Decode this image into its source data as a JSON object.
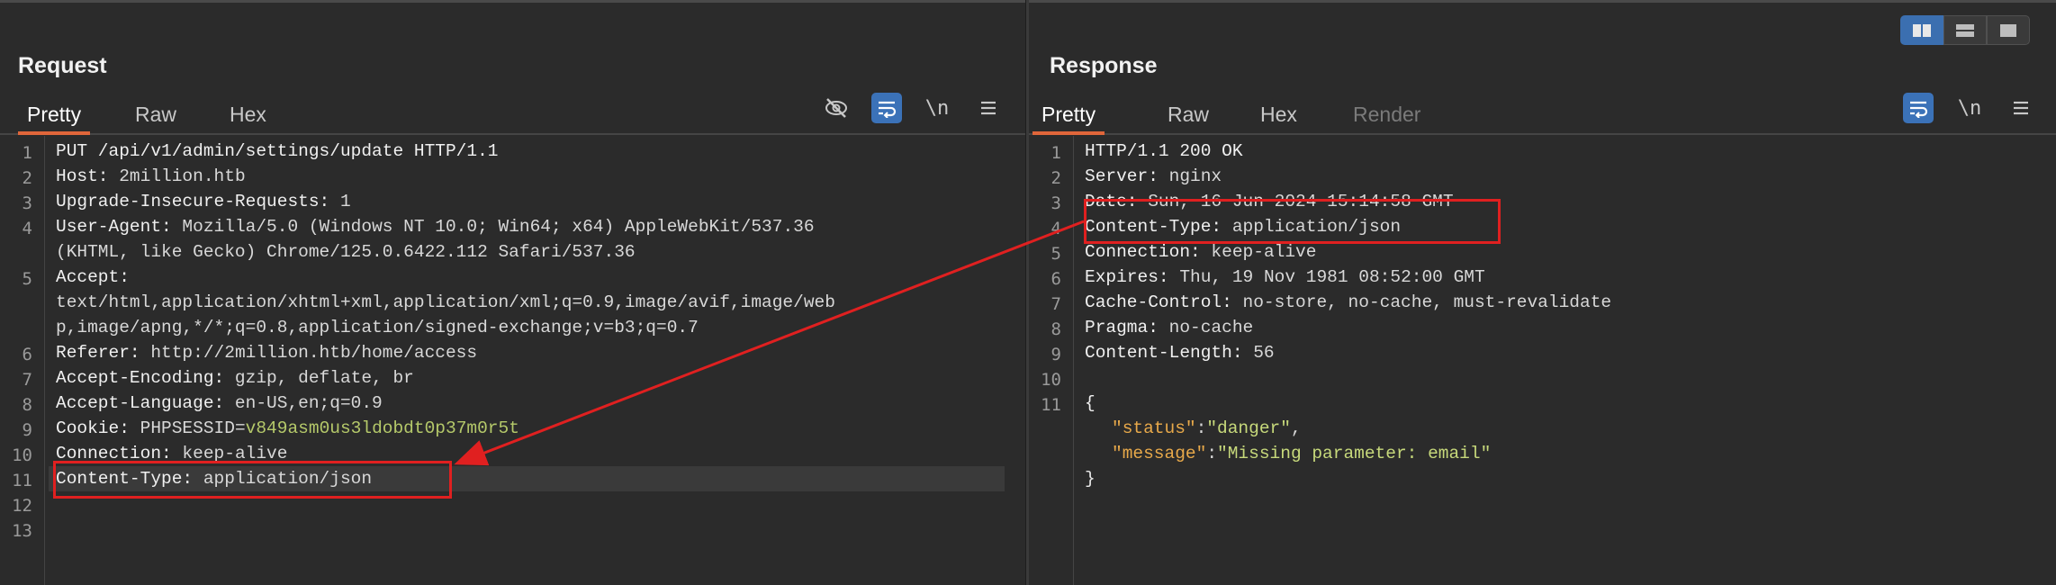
{
  "layout_toggle": {
    "options": [
      "split-horizontal",
      "split-vertical",
      "single"
    ],
    "selected": "split-horizontal"
  },
  "request": {
    "title": "Request",
    "tabs": [
      "Pretty",
      "Raw",
      "Hex"
    ],
    "active_tab": "Pretty",
    "toolbar": {
      "newline_label": "\\n"
    },
    "line_numbers": [
      "1",
      "2",
      "3",
      "4",
      "5",
      "6",
      "7",
      "8",
      "9",
      "10",
      "11",
      "12",
      "13"
    ],
    "lines": [
      {
        "num": "1",
        "header": "PUT /api/v1/admin/settings/update HTTP/1.1",
        "value": ""
      },
      {
        "num": "2",
        "header": "Host:",
        "value": " 2million.htb"
      },
      {
        "num": "3",
        "header": "Upgrade-Insecure-Requests:",
        "value": " 1"
      },
      {
        "num": "4",
        "header": "User-Agent:",
        "value": " Mozilla/5.0 (Windows NT 10.0; Win64; x64) AppleWebKit/537.36"
      },
      {
        "num": "",
        "header": "",
        "value": "(KHTML, like Gecko) Chrome/125.0.6422.112 Safari/537.36"
      },
      {
        "num": "5",
        "header": "Accept:",
        "value": ""
      },
      {
        "num": "",
        "header": "",
        "value": "text/html,application/xhtml+xml,application/xml;q=0.9,image/avif,image/web"
      },
      {
        "num": "",
        "header": "",
        "value": "p,image/apng,*/*;q=0.8,application/signed-exchange;v=b3;q=0.7"
      },
      {
        "num": "6",
        "header": "Referer:",
        "value": " http://2million.htb/home/access"
      },
      {
        "num": "7",
        "header": "Accept-Encoding:",
        "value": " gzip, deflate, br"
      },
      {
        "num": "8",
        "header": "Accept-Language:",
        "value": " en-US,en;q=0.9"
      },
      {
        "num": "9",
        "header": "Cookie:",
        "value": " PHPSESSID=",
        "cookie": "v849asm0us3ldobdt0p37m0r5t"
      },
      {
        "num": "10",
        "header": "Connection:",
        "value": " keep-alive"
      },
      {
        "num": "11",
        "header": "Content-Type:",
        "value": " application/json"
      },
      {
        "num": "12",
        "header": "",
        "value": ""
      },
      {
        "num": "13",
        "header": "",
        "value": ""
      }
    ]
  },
  "response": {
    "title": "Response",
    "tabs": [
      "Pretty",
      "Raw",
      "Hex",
      "Render"
    ],
    "active_tab": "Pretty",
    "disabled_tab": "Render",
    "toolbar": {
      "newline_label": "\\n"
    },
    "lines": [
      {
        "num": "1",
        "header": "HTTP/1.1 200 OK",
        "value": ""
      },
      {
        "num": "2",
        "header": "Server:",
        "value": " nginx"
      },
      {
        "num": "3",
        "header": "Date:",
        "value": " Sun, 16 Jun 2024 15:14:58 GMT"
      },
      {
        "num": "4",
        "header": "Content-Type:",
        "value": " application/json"
      },
      {
        "num": "5",
        "header": "Connection:",
        "value": " keep-alive"
      },
      {
        "num": "6",
        "header": "Expires:",
        "value": " Thu, 19 Nov 1981 08:52:00 GMT"
      },
      {
        "num": "7",
        "header": "Cache-Control:",
        "value": " no-store, no-cache, must-revalidate"
      },
      {
        "num": "8",
        "header": "Pragma:",
        "value": " no-cache"
      },
      {
        "num": "9",
        "header": "Content-Length:",
        "value": " 56"
      },
      {
        "num": "10",
        "header": "",
        "value": ""
      },
      {
        "num": "11",
        "header": "{",
        "value": ""
      }
    ],
    "json_body": [
      {
        "key": "\"status\"",
        "sep": ":",
        "val": "\"danger\"",
        "tail": ","
      },
      {
        "key": "\"message\"",
        "sep": ":",
        "val": "\"Missing parameter: email\"",
        "tail": ""
      }
    ],
    "json_close": "}"
  },
  "colors": {
    "annotation_red": "#e02020",
    "accent_orange": "#e0663a",
    "toolbar_blue": "#3b72b8"
  }
}
